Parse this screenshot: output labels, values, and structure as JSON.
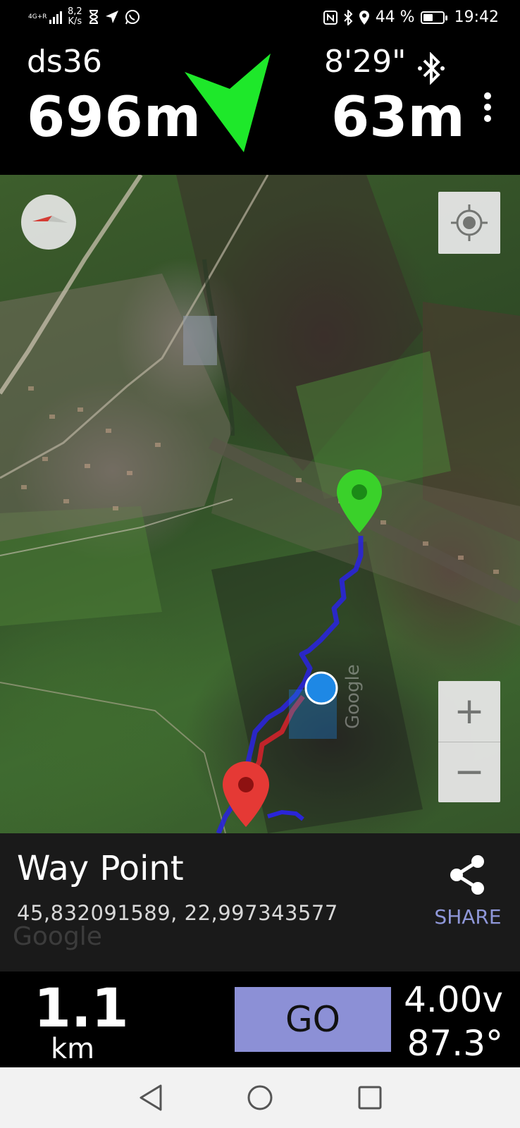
{
  "status_bar": {
    "network": "4G+R",
    "speed_value": "8,2",
    "speed_unit": "K/s",
    "battery": "44 %",
    "time": "19:42"
  },
  "header": {
    "waypoint_name": "ds36",
    "distance": "696m",
    "time": "8'29\"",
    "altitude": "63m",
    "arrow_color": "#1ee82a"
  },
  "map": {
    "zoom_in": "+",
    "zoom_out": "−",
    "watermark": "Google",
    "start_pin_color": "#3ad12a",
    "end_pin_color": "#e53935",
    "route_color": "#2a25d8",
    "track_color": "#c0242a",
    "position_color": "#1e88e5"
  },
  "info_panel": {
    "title": "Way Point",
    "coordinates": "45,832091589, 22,997343577",
    "share_label": "SHARE",
    "watermark": "Google"
  },
  "bottom_bar": {
    "distance": "1.1",
    "distance_unit": "km",
    "go_label": "GO",
    "voltage": "4.00v",
    "heading": "87.3°"
  },
  "nav_bar": {
    "back_icon": "triangle-back",
    "home_icon": "circle-home",
    "recents_icon": "square-recents"
  }
}
